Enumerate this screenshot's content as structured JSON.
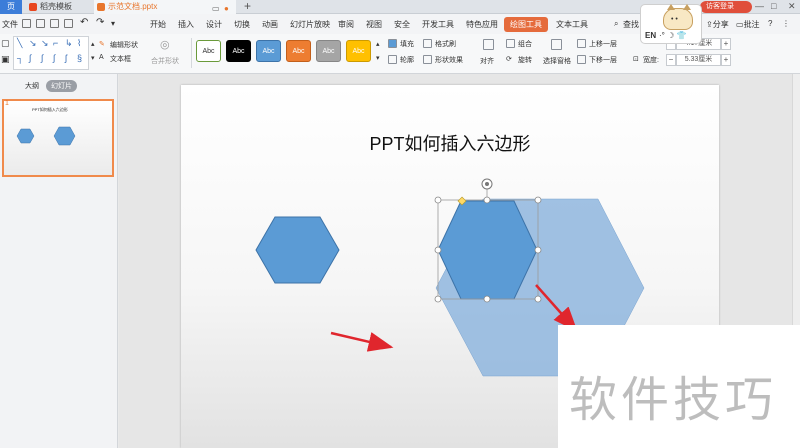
{
  "titlebar": {
    "home_tab": "页",
    "template_tab": "稻壳模板",
    "active_tab": "示范文档.pptx",
    "new_tab_symbol": "+",
    "visitor_login": "访客登录",
    "minimize_symbol": "—",
    "maximize_symbol": "□",
    "close_symbol": "✕"
  },
  "menubar": {
    "file": "文件",
    "items": [
      "开始",
      "插入",
      "设计",
      "切换",
      "动画",
      "幻灯片放映",
      "审阅",
      "视图",
      "安全",
      "开发工具",
      "特色应用",
      "绘图工具",
      "文本工具"
    ],
    "active_index": 11,
    "right": {
      "search": "查找",
      "share": "分享",
      "comment": "批注"
    }
  },
  "ribbon": {
    "edit_shape": "编辑形状",
    "text_box": "文本框",
    "merge_shape": "合并形状",
    "style_swatches": [
      {
        "label": "Abc",
        "bg": "#ffffff",
        "fg": "#333333",
        "border": "#6a9a3a"
      },
      {
        "label": "Abc",
        "bg": "#000000",
        "fg": "#ffffff",
        "border": "#000000"
      },
      {
        "label": "Abc",
        "bg": "#5b9bd5",
        "fg": "#ffffff",
        "border": "#3d73a8"
      },
      {
        "label": "Abc",
        "bg": "#ed7d31",
        "fg": "#ffffff",
        "border": "#c25f1b"
      },
      {
        "label": "Abc",
        "bg": "#a5a5a5",
        "fg": "#ffffff",
        "border": "#868686"
      },
      {
        "label": "Abc",
        "bg": "#ffc000",
        "fg": "#ffffff",
        "border": "#cc9a00"
      }
    ],
    "fill": "填充",
    "format_painter": "格式刷",
    "outline": "轮廓",
    "shape_effect": "形状效果",
    "align": "对齐",
    "combine": "组合",
    "rotate": "旋转",
    "selection_pane": "选择窗格",
    "bring_forward": "上移一层",
    "send_backward": "下移一层",
    "height_value": "4.17厘米",
    "width_label": "宽度:",
    "width_value": "5.33厘米"
  },
  "ime": {
    "lang": "EN",
    "icons": "·° ☽ 👕"
  },
  "leftpanel": {
    "outline_tab": "大纲",
    "slides_tab": "幻灯片",
    "slide_number": "1",
    "thumb_title": "PPT如何插入六边形"
  },
  "slide": {
    "title": "PPT如何插入六边形",
    "hexagon_fill": "#5b9bd5",
    "large_hexagon_fill": "#8fb6de",
    "arrow_color": "#e0262d"
  },
  "watermark": {
    "text": "软件技巧"
  }
}
